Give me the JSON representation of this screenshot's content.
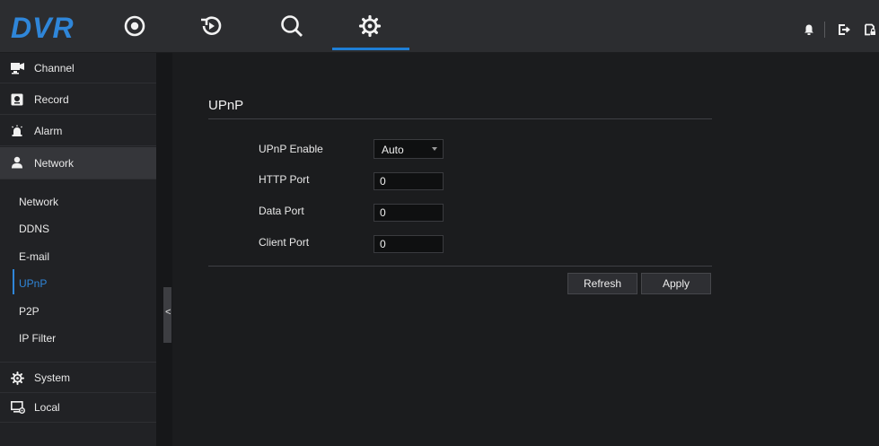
{
  "header": {
    "logo": "DVR",
    "nav": [
      {
        "icon": "live-view-icon"
      },
      {
        "icon": "playback-icon"
      },
      {
        "icon": "search-icon"
      },
      {
        "icon": "settings-icon",
        "active": true
      }
    ],
    "right_icons": [
      "notification-icon",
      "logout-icon",
      "lock-icon"
    ]
  },
  "sidebar": {
    "items": [
      {
        "label": "Channel",
        "icon": "channel-icon"
      },
      {
        "label": "Record",
        "icon": "record-icon"
      },
      {
        "label": "Alarm",
        "icon": "alarm-icon"
      },
      {
        "label": "Network",
        "icon": "network-icon",
        "active": true
      },
      {
        "label": "System",
        "icon": "system-icon"
      },
      {
        "label": "Local",
        "icon": "local-icon"
      }
    ],
    "subitems": [
      {
        "label": "Network"
      },
      {
        "label": "DDNS"
      },
      {
        "label": "E-mail"
      },
      {
        "label": "UPnP",
        "active": true
      },
      {
        "label": "P2P"
      },
      {
        "label": "IP Filter"
      }
    ],
    "collapse_label": "<"
  },
  "main": {
    "title": "UPnP",
    "fields": [
      {
        "label": "UPnP Enable",
        "value": "Auto",
        "type": "select"
      },
      {
        "label": "HTTP Port",
        "value": "0"
      },
      {
        "label": "Data Port",
        "value": "0"
      },
      {
        "label": "Client Port",
        "value": "0"
      }
    ],
    "buttons": {
      "refresh": "Refresh",
      "apply": "Apply"
    }
  },
  "colors": {
    "accent": "#2f86d9",
    "background": "#1b1c1e",
    "topbar": "#2c2d30",
    "sidebar": "#212225"
  }
}
